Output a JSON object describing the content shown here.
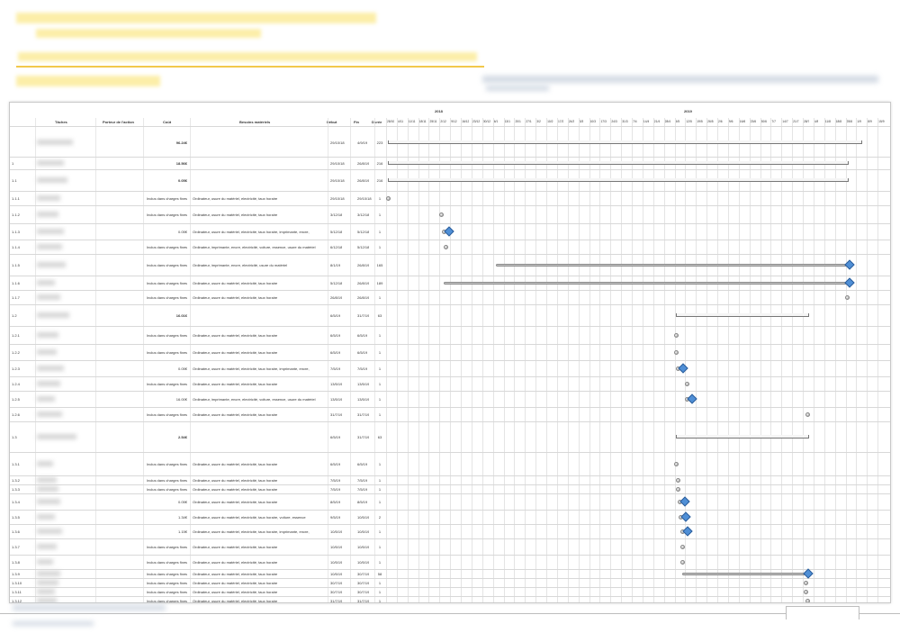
{
  "columns": {
    "tasks": "Tâches",
    "owner": "Porteur de l'action",
    "cost": "Coût",
    "needs": "Besoins matériels",
    "start": "Début",
    "end": "Fin",
    "duration": "Durée"
  },
  "years": [
    "2018",
    "2019"
  ],
  "weeks": [
    "28/10",
    "4/11",
    "11/11",
    "18/11",
    "25/11",
    "2/12",
    "9/12",
    "16/12",
    "23/12",
    "30/12",
    "6/1",
    "13/1",
    "20/1",
    "27/1",
    "3/2",
    "10/2",
    "17/2",
    "24/2",
    "3/3",
    "10/3",
    "17/3",
    "24/3",
    "31/3",
    "7/4",
    "14/4",
    "21/4",
    "28/4",
    "5/5",
    "12/5",
    "19/5",
    "26/5",
    "2/6",
    "9/6",
    "16/6",
    "23/6",
    "30/6",
    "7/7",
    "14/7",
    "21/7",
    "28/7",
    "4/8",
    "11/8",
    "18/8",
    "25/8",
    "1/9",
    "8/9",
    "15/9"
  ],
  "rows": [
    {
      "id": "",
      "cost": "96.24€",
      "needs": "",
      "start": "29/10/18",
      "end": "4/9/19",
      "dur": "223",
      "summary": true
    },
    {
      "id": "1",
      "cost": "18.56€",
      "needs": "",
      "start": "29/10/18",
      "end": "26/8/19",
      "dur": "216",
      "summary": true
    },
    {
      "id": "1.1",
      "cost": "0.05€",
      "needs": "",
      "start": "29/10/18",
      "end": "26/8/19",
      "dur": "216",
      "summary": true
    },
    {
      "id": "1.1.1",
      "cost": "Inclus dans charges fixes",
      "needs": "Ordinateur, usure du matériel, electricité, taux horaire",
      "start": "29/10/18",
      "end": "29/10/18",
      "dur": "1"
    },
    {
      "id": "1.1.2",
      "cost": "Inclus dans charges fixes",
      "needs": "Ordinateur, usure du matériel, electricité, taux horaire",
      "start": "3/12/18",
      "end": "3/12/18",
      "dur": "1"
    },
    {
      "id": "1.1.3",
      "cost": "0.05€",
      "needs": "Ordinateur, usure du matériel, electricité, taux horaire, imprimante, encre,",
      "start": "5/12/18",
      "end": "5/12/18",
      "dur": "1"
    },
    {
      "id": "1.1.4",
      "cost": "Inclus dans charges fixes",
      "needs": "Ordinateur, imprimante, encre, electricité, voiture, essence, usure du matériel",
      "start": "6/12/18",
      "end": "5/12/18",
      "dur": "1"
    },
    {
      "id": "1.1.5",
      "cost": "Inclus dans charges fixes",
      "needs": "Ordinateur, imprimante, encre, electricité, usure du matériel",
      "start": "8/1/19",
      "end": "26/8/19",
      "dur": "165"
    },
    {
      "id": "1.1.6",
      "cost": "Inclus dans charges fixes",
      "needs": "Ordinateur, usure du matériel, electricité, taux horaire",
      "start": "5/12/18",
      "end": "26/8/19",
      "dur": "189"
    },
    {
      "id": "1.1.7",
      "cost": "Inclus dans charges fixes",
      "needs": "Ordinateur, usure du matériel, electricité, taux horaire",
      "start": "26/8/19",
      "end": "26/8/19",
      "dur": "1"
    },
    {
      "id": "1.2",
      "cost": "16.01€",
      "needs": "",
      "start": "6/5/19",
      "end": "31/7/19",
      "dur": "63",
      "summary": true
    },
    {
      "id": "1.2.1",
      "cost": "Inclus dans charges fixes",
      "needs": "Ordinateur, usure du matériel, electricité, taux horaire",
      "start": "6/5/19",
      "end": "6/5/19",
      "dur": "1"
    },
    {
      "id": "1.2.2",
      "cost": "Inclus dans charges fixes",
      "needs": "Ordinateur, usure du matériel, electricité, taux horaire",
      "start": "6/5/19",
      "end": "6/5/19",
      "dur": "1"
    },
    {
      "id": "1.2.3",
      "cost": "0.05€",
      "needs": "Ordinateur, usure du matériel, electricité, taux horaire, imprimante, encre,",
      "start": "7/5/19",
      "end": "7/5/19",
      "dur": "1"
    },
    {
      "id": "1.2.4",
      "cost": "Inclus dans charges fixes",
      "needs": "Ordinateur, usure du matériel, electricité, taux horaire",
      "start": "13/5/19",
      "end": "13/5/19",
      "dur": "1"
    },
    {
      "id": "1.2.5",
      "cost": "16.00€",
      "needs": "Ordinateur, imprimante, encre, electricité, voiture, essence, usure du matériel",
      "start": "13/5/19",
      "end": "13/5/19",
      "dur": "1"
    },
    {
      "id": "1.2.6",
      "cost": "Inclus dans charges fixes",
      "needs": "Ordinateur, usure du matériel, electricité, taux horaire",
      "start": "31/7/19",
      "end": "31/7/19",
      "dur": "1"
    },
    {
      "id": "1.3",
      "cost": "2.54€",
      "needs": "",
      "start": "6/5/19",
      "end": "31/7/19",
      "dur": "63",
      "summary": true
    },
    {
      "id": "1.3.1",
      "cost": "Inclus dans charges fixes",
      "needs": "Ordinateur, usure du matériel, electricité, taux horaire",
      "start": "6/5/19",
      "end": "6/5/19",
      "dur": "1"
    },
    {
      "id": "1.3.2",
      "cost": "Inclus dans charges fixes",
      "needs": "Ordinateur, usure du matériel, electricité, taux horaire",
      "start": "7/5/19",
      "end": "7/5/19",
      "dur": "1"
    },
    {
      "id": "1.3.3",
      "cost": "Inclus dans charges fixes",
      "needs": "Ordinateur, usure du matériel, electricité, taux horaire",
      "start": "7/5/19",
      "end": "7/5/19",
      "dur": "1"
    },
    {
      "id": "1.3.4",
      "cost": "0.05€",
      "needs": "Ordinateur, usure du matériel, electricité, taux horaire",
      "start": "8/5/19",
      "end": "8/5/19",
      "dur": "1"
    },
    {
      "id": "1.3.5",
      "cost": "1.34€",
      "needs": "Ordinateur, usure du matériel, electricité, taux horaire, voiture, essence",
      "start": "9/5/19",
      "end": "10/5/19",
      "dur": "2"
    },
    {
      "id": "1.3.6",
      "cost": "1.15€",
      "needs": "Ordinateur, usure du matériel, electricité, taux horaire, imprimante, encre,",
      "start": "10/5/19",
      "end": "10/5/19",
      "dur": "1"
    },
    {
      "id": "1.3.7",
      "cost": "Inclus dans charges fixes",
      "needs": "Ordinateur, usure du matériel, electricité, taux horaire",
      "start": "10/5/19",
      "end": "10/5/19",
      "dur": "1"
    },
    {
      "id": "1.3.8",
      "cost": "Inclus dans charges fixes",
      "needs": "Ordinateur, usure du matériel, electricité, taux horaire",
      "start": "10/5/19",
      "end": "10/5/19",
      "dur": "1"
    },
    {
      "id": "1.3.9",
      "cost": "Inclus dans charges fixes",
      "needs": "Ordinateur, usure du matériel, electricité, taux horaire",
      "start": "10/5/19",
      "end": "30/7/19",
      "dur": "58"
    },
    {
      "id": "1.3.10",
      "cost": "Inclus dans charges fixes",
      "needs": "Ordinateur, usure du matériel, electricité, taux horaire",
      "start": "30/7/19",
      "end": "30/7/19",
      "dur": "1"
    },
    {
      "id": "1.3.11",
      "cost": "Inclus dans charges fixes",
      "needs": "Ordinateur, usure du matériel, electricité, taux horaire",
      "start": "30/7/19",
      "end": "30/7/19",
      "dur": "1"
    },
    {
      "id": "1.3.12",
      "cost": "Inclus dans charges fixes",
      "needs": "Ordinateur, usure du matériel, electricité, taux horaire",
      "start": "31/7/19",
      "end": "31/7/19",
      "dur": "1"
    }
  ]
}
